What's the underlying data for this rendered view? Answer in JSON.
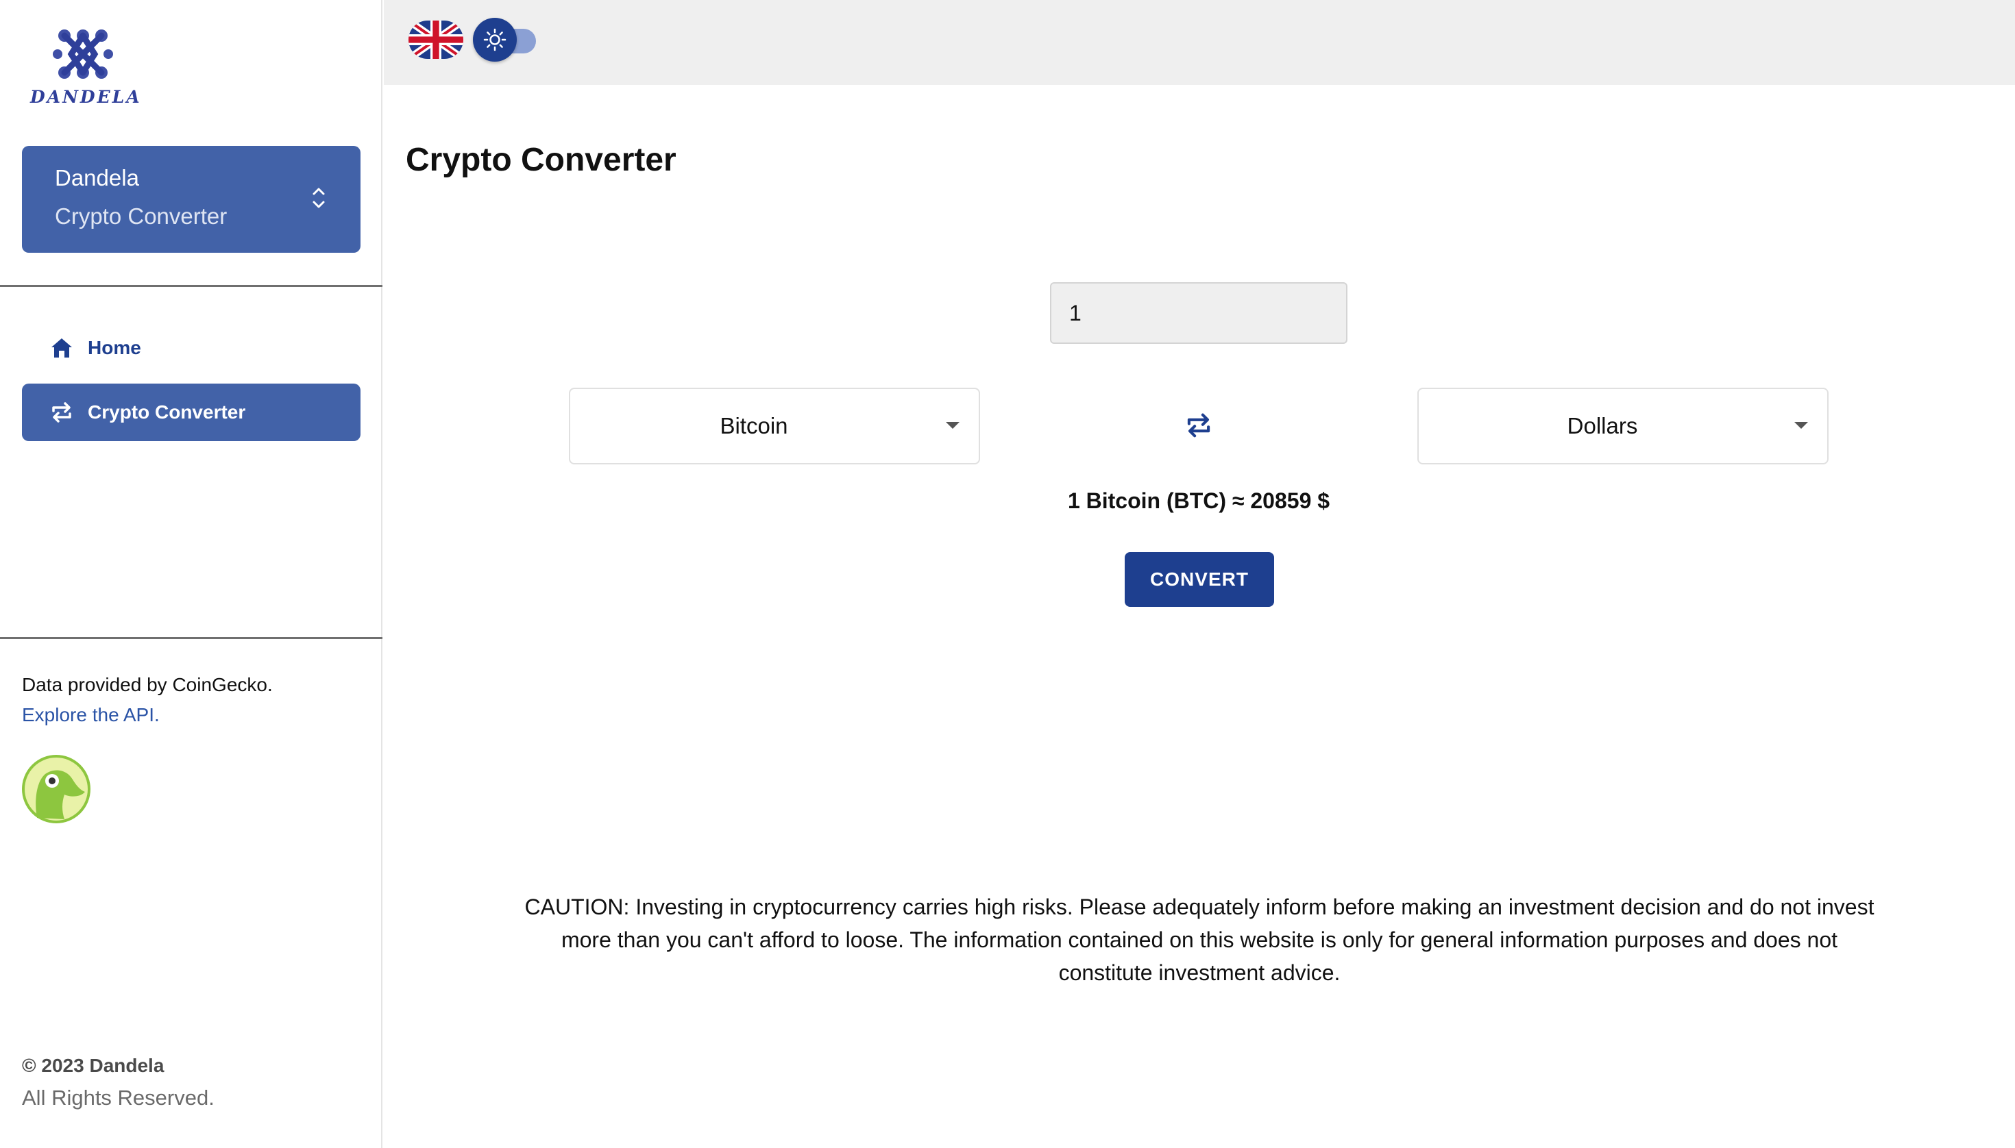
{
  "brand": {
    "logo_text": "DANDELA"
  },
  "sidebar": {
    "app_switcher": {
      "line1": "Dandela",
      "line2": "Crypto Converter"
    },
    "nav": [
      {
        "label": "Home",
        "icon": "home-icon"
      },
      {
        "label": "Crypto Converter",
        "icon": "swap-icon",
        "active": true
      }
    ],
    "credit_text": "Data provided by CoinGecko.",
    "api_link": "Explore the API.",
    "copyright": "© 2023 Dandela",
    "rights": "All Rights Reserved."
  },
  "topbar": {
    "language_icon": "uk-flag-icon",
    "theme_icon": "sun-icon"
  },
  "main": {
    "title": "Crypto Converter",
    "amount_value": "1",
    "from_currency": "Bitcoin",
    "to_currency": "Dollars",
    "rate_text": "1 Bitcoin (BTC) ≈ 20859 $",
    "convert_label": "CONVERT",
    "caution_text": "CAUTION: Investing in cryptocurrency carries high risks. Please adequately inform before making an investment decision and do not invest more than you can't afford to loose. The information contained on this website is only for general information purposes and does not constitute investment advice."
  },
  "colors": {
    "primary": "#1e3f8f",
    "sidebar_active": "#4262a8",
    "link": "#2a53a6",
    "topbar_bg": "#efefef"
  }
}
